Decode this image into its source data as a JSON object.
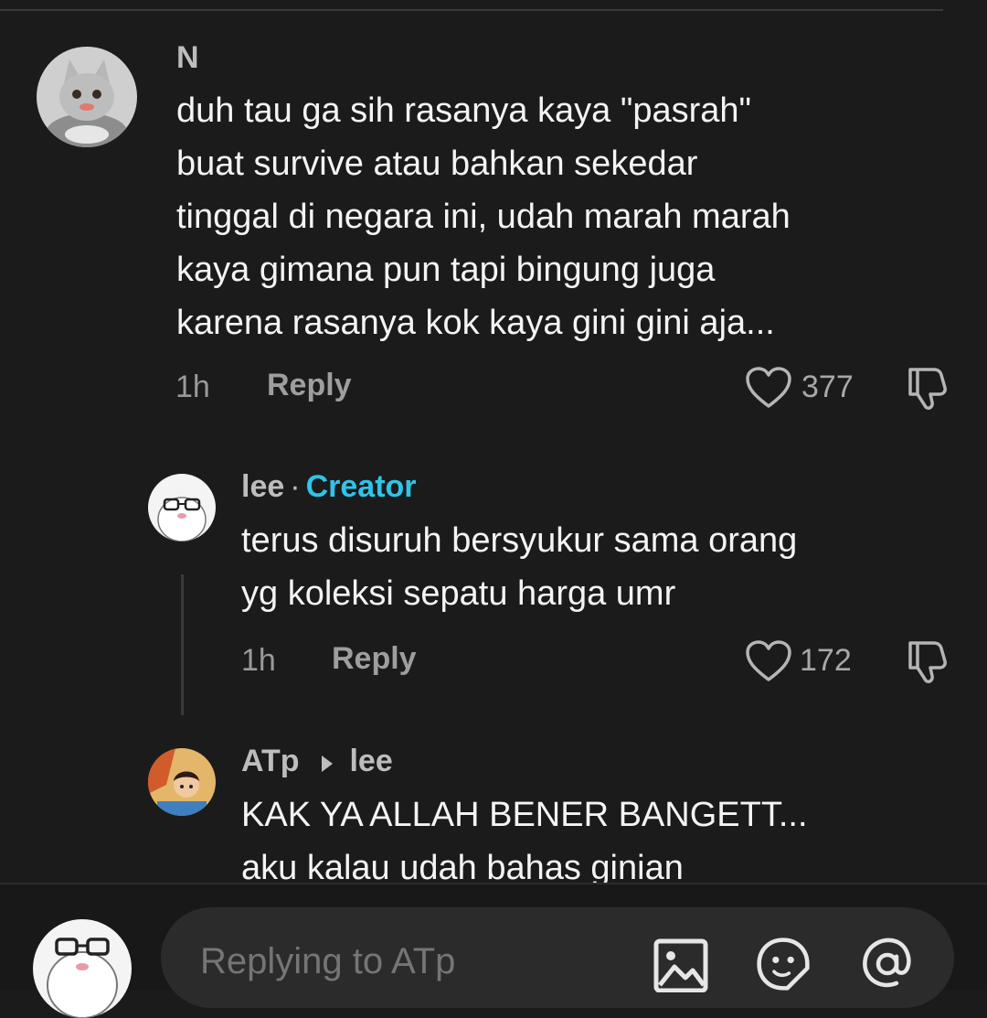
{
  "comments": [
    {
      "username": "N",
      "text": "duh tau ga sih rasanya kaya \"pasrah\"\nbuat survive atau bahkan sekedar\ntinggal di negara ini, udah marah marah\nkaya gimana pun tapi bingung juga\nkarena rasanya kok kaya gini gini aja...",
      "time": "1h",
      "reply_label": "Reply",
      "likes": "377"
    },
    {
      "username": "lee",
      "separator": "·",
      "badge": "Creator",
      "text": "terus disuruh bersyukur sama orang\nyg koleksi sepatu harga umr",
      "time": "1h",
      "reply_label": "Reply",
      "likes": "172"
    },
    {
      "username": "ATp",
      "reply_to": "lee",
      "text": "KAK YA ALLAH BENER BANGETT...\naku kalau udah bahas ginian"
    }
  ],
  "composer": {
    "placeholder": "Replying to ATp"
  },
  "icons": {
    "like": "heart-outline-icon",
    "dislike": "thumbs-down-icon",
    "reply_arrow": "caret-right-icon",
    "image": "image-icon",
    "emoji": "emoji-icon",
    "mention": "at-sign-icon"
  }
}
